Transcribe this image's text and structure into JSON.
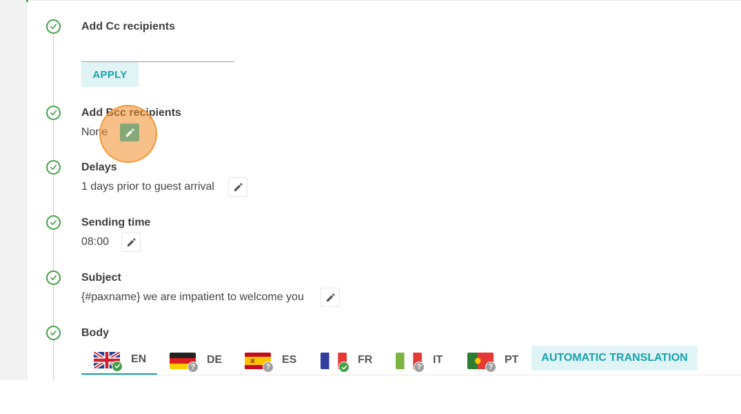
{
  "colors": {
    "check_green": "#43a047",
    "accent_teal": "#17a2ad",
    "button_bg": "#e0f4f6",
    "highlight_orange": "#f28c28"
  },
  "steps": {
    "cc": {
      "title": "Add Cc recipients",
      "input_value": "",
      "apply_label": "APPLY"
    },
    "bcc": {
      "title": "Add Bcc recipients",
      "value": "None"
    },
    "delays": {
      "title": "Delays",
      "value": "1 days prior to guest arrival"
    },
    "sending_time": {
      "title": "Sending time",
      "value": "08:00"
    },
    "subject": {
      "title": "Subject",
      "value": "{#paxname} we are impatient to welcome you"
    },
    "body": {
      "title": "Body"
    }
  },
  "languages": [
    {
      "code": "EN",
      "flag": "uk-flag",
      "status": "translated",
      "active": true
    },
    {
      "code": "DE",
      "flag": "germany-flag",
      "status": "unknown",
      "active": false
    },
    {
      "code": "ES",
      "flag": "spain-flag",
      "status": "unknown",
      "active": false
    },
    {
      "code": "FR",
      "flag": "france-flag",
      "status": "translated",
      "active": false
    },
    {
      "code": "IT",
      "flag": "italy-flag",
      "status": "unknown",
      "active": false
    },
    {
      "code": "PT",
      "flag": "portugal-flag",
      "status": "unknown",
      "active": false
    }
  ],
  "badge_unknown_symbol": "?",
  "auto_translation_label": "AUTOMATIC TRANSLATION"
}
